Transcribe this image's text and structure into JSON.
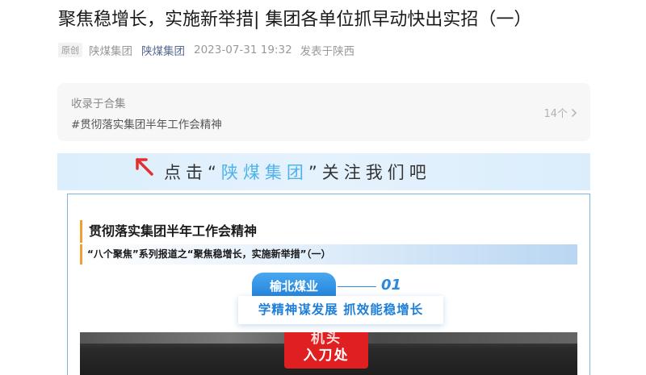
{
  "article": {
    "title": "聚焦稳增长，实施新举措| 集团各单位抓早动快出实招（一）",
    "original_badge": "原创",
    "author": "陕煤集团",
    "account": "陕煤集团",
    "date": "2023-07-31 19:32",
    "location": "发表于陕西"
  },
  "collection": {
    "label": "收录于合集",
    "name": "#贯彻落实集团半年工作会精神",
    "count": "14个"
  },
  "follow_banner": {
    "prefix": "点击“",
    "highlight": "陕煤集团",
    "suffix": "”关注我们吧"
  },
  "content": {
    "section_title": "贯彻落实集团半年工作会精神",
    "section_subtitle": "“八个聚焦”系列报道之“聚焦稳增长，实施新举措”（一）",
    "unit_name": "榆北煤业",
    "unit_number": "01",
    "slogan": "学精神谋发展 抓效能稳增长",
    "photo_sign_line1": "机头",
    "photo_sign_line2": "入刀处"
  },
  "colors": {
    "accent_blue": "#1e7fd8",
    "link_blue": "#576b95",
    "sign_red": "#e02020",
    "orange_bar": "#f0a030"
  },
  "icons": {
    "collection_chevron": "chevron-right-icon",
    "follow_arrow": "arrow-up-left-icon"
  }
}
